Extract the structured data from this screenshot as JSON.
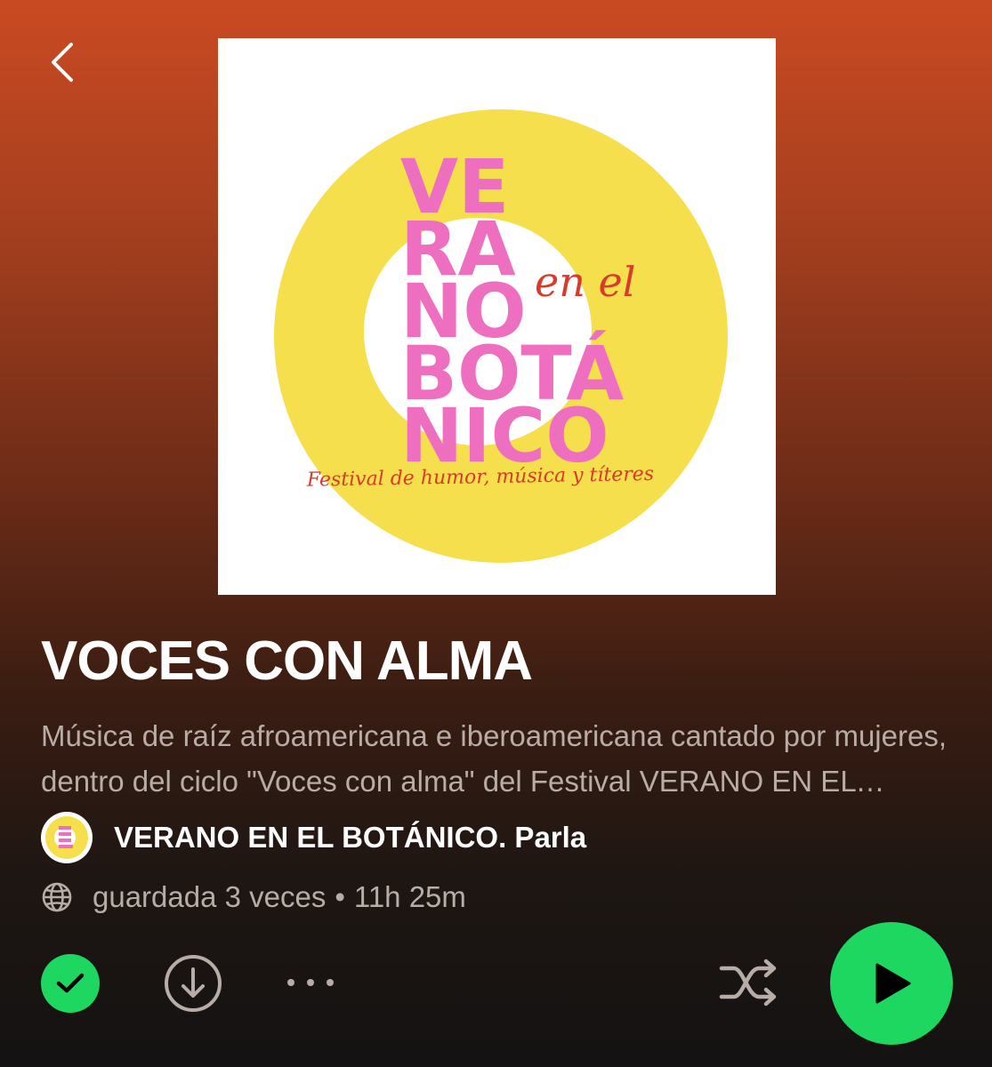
{
  "header": {
    "back_icon": "chevron-left-icon"
  },
  "cover": {
    "line1": "VE",
    "line2": "RA",
    "line3": "NO",
    "line4": "BOTÁ",
    "line5": "NICO",
    "script_text": "en el",
    "tagline": "Festival de humor, música y títeres",
    "colors": {
      "circle": "#f5df4d",
      "letters": "#ee6fc0",
      "script": "#d93a2b"
    }
  },
  "playlist": {
    "title": "VOCES CON ALMA",
    "description": "Música de raíz afroamericana e iberoamericana cantado por mujeres, dentro del ciclo \"Voces con alma\" del Festival VERANO EN EL BOTÁNICO",
    "owner": "VERANO EN EL BOTÁNICO. Parla",
    "saves": "guardada 3 veces",
    "separator": "•",
    "duration": "11h 25m",
    "visibility_icon": "globe-icon"
  },
  "controls": {
    "saved_icon": "check-icon",
    "download_icon": "download-icon",
    "more_icon": "more-icon",
    "shuffle_icon": "shuffle-icon",
    "play_icon": "play-icon",
    "accent": "#1ed760"
  }
}
